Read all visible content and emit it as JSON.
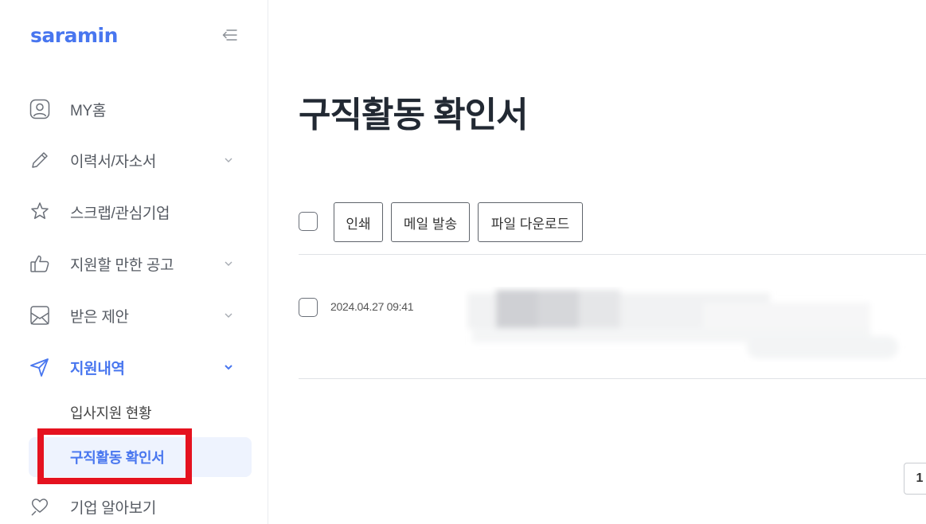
{
  "sidebar": {
    "logo": "saramin",
    "collapse_icon": "collapse-left-icon",
    "items": [
      {
        "label": "MY홈",
        "icon": "user-icon",
        "has_chevron": false
      },
      {
        "label": "이력서/자소서",
        "icon": "pencil-icon",
        "has_chevron": true
      },
      {
        "label": "스크랩/관심기업",
        "icon": "star-icon",
        "has_chevron": false
      },
      {
        "label": "지원할 만한 공고",
        "icon": "thumbs-up-icon",
        "has_chevron": true
      },
      {
        "label": "받은 제안",
        "icon": "envelope-icon",
        "has_chevron": true
      },
      {
        "label": "지원내역",
        "icon": "send-icon",
        "has_chevron": true,
        "active": true
      },
      {
        "label": "기업 알아보기",
        "icon": "heart-search-icon",
        "has_chevron": false
      }
    ],
    "sub_items": [
      {
        "label": "입사지원 현황"
      },
      {
        "label": "구직활동 확인서",
        "selected": true
      }
    ]
  },
  "main": {
    "title": "구직활동 확인서",
    "toolbar": {
      "print_label": "인쇄",
      "mail_label": "메일 발송",
      "download_label": "파일 다운로드"
    },
    "rows": [
      {
        "date": "2024.04.27 09:41"
      }
    ],
    "pagination": {
      "current_page": "1"
    }
  },
  "colors": {
    "accent": "#4876ef",
    "highlight": "#e5121f",
    "title": "#222933"
  }
}
